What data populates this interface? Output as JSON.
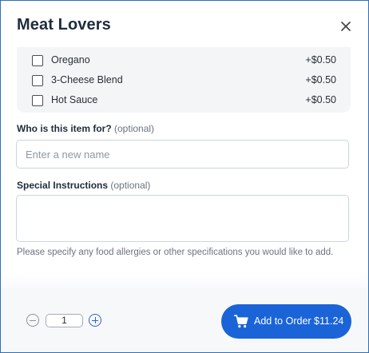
{
  "modal": {
    "title": "Meat Lovers",
    "close_icon": "close-icon"
  },
  "options": [
    {
      "label": "Oregano",
      "price": "+$0.50",
      "checked": false
    },
    {
      "label": "3-Cheese Blend",
      "price": "+$0.50",
      "checked": false
    },
    {
      "label": "Hot Sauce",
      "price": "+$0.50",
      "checked": false
    }
  ],
  "recipient": {
    "label": "Who is this item for?",
    "optional": "(optional)",
    "placeholder": "Enter a new name",
    "value": ""
  },
  "instructions": {
    "label": "Special Instructions",
    "optional": "(optional)",
    "value": "",
    "helper": "Please specify any food allergies or other specifications you would like to add."
  },
  "footer": {
    "quantity": "1",
    "decrement_icon": "minus-circle-icon",
    "increment_icon": "plus-circle-icon",
    "add_label": "Add to Order $11.24",
    "cart_icon": "shopping-cart-icon"
  },
  "colors": {
    "accent": "#1a64d8",
    "border": "#2f6fb5"
  }
}
